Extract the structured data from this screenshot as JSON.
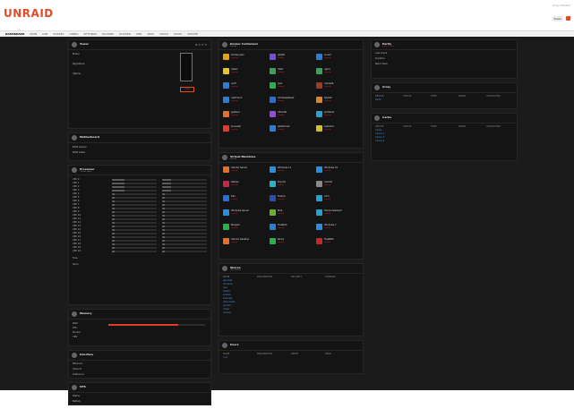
{
  "brand": {
    "logo": "UNRAID",
    "subtitle": "v6.x.x"
  },
  "header_right": {
    "status_text": "Array Started",
    "user_label": "Tower"
  },
  "nav": {
    "tabs": [
      "DASHBOARD",
      "MAIN",
      "USB",
      "SHARES",
      "USERS",
      "SETTINGS",
      "PLUGINS",
      "DOCKER",
      "VMS",
      "APPS",
      "TOOLS",
      "STATS",
      "UPDATE"
    ]
  },
  "colors": {
    "accent": "#e04b2a",
    "bg": "#1b1b1b",
    "panel": "#141414",
    "red": "#e53a2b"
  },
  "server": {
    "title": "Tower",
    "lines": [
      "Model",
      "Registered",
      "Uptime"
    ],
    "stop_label": "STOP"
  },
  "motherboard": {
    "title": "Motherboard",
    "line1": "BIOS Version",
    "line2": "BIOS dated"
  },
  "processor": {
    "title": "Processor",
    "sub": "Overall Load",
    "rows": [
      "CPU 0",
      "CPU 1",
      "CPU 2",
      "CPU 3",
      "CPU 4",
      "CPU 5",
      "CPU 6",
      "CPU 7",
      "CPU 8",
      "CPU 9",
      "CPU 10",
      "CPU 11",
      "CPU 12",
      "CPU 13",
      "CPU 14",
      "CPU 15",
      "CPU 16",
      "CPU 17",
      "CPU 18",
      "CPU 19",
      "CPU 20"
    ],
    "footer_rows": [
      "Fans",
      "Temp"
    ]
  },
  "memory": {
    "title": "Memory",
    "legend": [
      "RAM",
      "ZFS",
      "Docker",
      "VMs"
    ],
    "bar_pct": 72
  },
  "interface": {
    "title": "Interface",
    "rows": [
      "Ethernet",
      "Inbound",
      "Outbound"
    ]
  },
  "ups": {
    "title": "UPS",
    "rows": [
      "Status",
      "Battery"
    ]
  },
  "docker": {
    "title": "Docker Containers",
    "status": "started",
    "items": [
      {
        "name": "binhex-plex",
        "color": "#e5a00d"
      },
      {
        "name": "jellyfin",
        "color": "#7a4bd6"
      },
      {
        "name": "sonarr",
        "color": "#2a7fd4"
      },
      {
        "name": "radarr",
        "color": "#e5c72a"
      },
      {
        "name": "lidarr",
        "color": "#3aa05c"
      },
      {
        "name": "nginx",
        "color": "#3aa05c"
      },
      {
        "name": "unifi",
        "color": "#2a7fd4"
      },
      {
        "name": "plex",
        "color": "#2ab04c"
      },
      {
        "name": "mariadb",
        "color": "#9a3a2a"
      },
      {
        "name": "nextcloud",
        "color": "#2a7fd4"
      },
      {
        "name": "homeassistant",
        "color": "#2a6fd4"
      },
      {
        "name": "tautulli",
        "color": "#d4862a"
      },
      {
        "name": "grafana",
        "color": "#e0702a"
      },
      {
        "name": "influxdb",
        "color": "#9a4bd6"
      },
      {
        "name": "portainer",
        "color": "#2a9fd4"
      },
      {
        "name": "krusader",
        "color": "#e53a2b"
      },
      {
        "name": "qbittorrent",
        "color": "#2a7fd4"
      },
      {
        "name": "sabnzbd",
        "color": "#d4c02a"
      }
    ],
    "state_label": "started"
  },
  "vms": {
    "title": "Virtual Machines",
    "status": "started",
    "items": [
      {
        "name": "Ubuntu Server",
        "color": "#e0702a"
      },
      {
        "name": "Windows 11",
        "color": "#2a8fe0"
      },
      {
        "name": "Windows 10",
        "color": "#2a8fe0"
      },
      {
        "name": "Debian",
        "color": "#c02a4a"
      },
      {
        "name": "Pop OS",
        "color": "#2ab0c0"
      },
      {
        "name": "macOS",
        "color": "#888888"
      },
      {
        "name": "Kali",
        "color": "#2a6fd4"
      },
      {
        "name": "Fedora",
        "color": "#2a4fb0"
      },
      {
        "name": "Arch",
        "color": "#2a9fd4"
      },
      {
        "name": "Windows Server",
        "color": "#2a8fe0"
      },
      {
        "name": "Mint",
        "color": "#6ab02a"
      },
      {
        "name": "Home Assistant",
        "color": "#2a9fd4"
      },
      {
        "name": "Manjaro",
        "color": "#2ab04c"
      },
      {
        "name": "TrueNAS",
        "color": "#2a7fd4"
      },
      {
        "name": "Windows 7",
        "color": "#2a8fe0"
      },
      {
        "name": "Ubuntu Desktop",
        "color": "#e0702a"
      },
      {
        "name": "Rocky",
        "color": "#2ab04c"
      },
      {
        "name": "FreeBSD",
        "color": "#c02a2a"
      }
    ],
    "state_label": "started"
  },
  "shares": {
    "title": "Shares",
    "sub": "User shares",
    "columns": [
      "NAME",
      "DESCRIPTION",
      "SECURITY",
      "STREAMS"
    ],
    "rows": [
      "appdata",
      "domains",
      "isos",
      "media",
      "system",
      "backups",
      "downloads",
      "photos",
      "music",
      "movies"
    ]
  },
  "users": {
    "title": "Users",
    "columns": [
      "NAME",
      "DESCRIPTION",
      "WRITE",
      "READ"
    ],
    "rows": [
      "root"
    ]
  },
  "parity": {
    "title": "Parity",
    "status": "Parity is valid",
    "lines": [
      "Last check",
      "Duration",
      "Next check"
    ]
  },
  "array": {
    "title": "Array",
    "columns": [
      "DEVICE",
      "STATUS",
      "TEMP",
      "SMART",
      "UTILIZATION"
    ],
    "rows": [
      "Parity"
    ]
  },
  "cache": {
    "title": "Cache",
    "columns": [
      "DEVICE",
      "STATUS",
      "TEMP",
      "SMART",
      "UTILIZATION"
    ],
    "rows": [
      "Cache",
      "Cache 2",
      "Cache 3",
      "Cache 4"
    ]
  }
}
